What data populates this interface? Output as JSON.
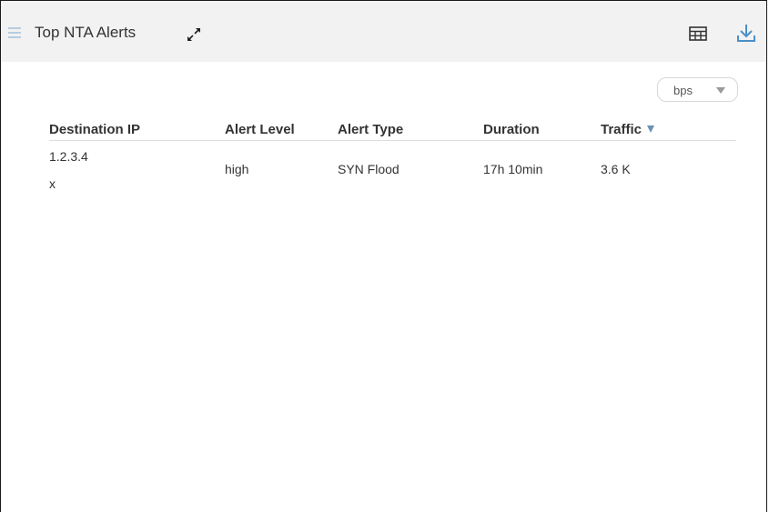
{
  "widget": {
    "title": "Top NTA Alerts",
    "icons": {
      "menu": "hamburger-menu-icon",
      "expand": "expand-arrows-icon",
      "table": "table-view-icon",
      "download": "download-icon"
    },
    "unit_select": {
      "value": "bps"
    }
  },
  "table": {
    "columns": [
      "Destination IP",
      "Alert Level",
      "Alert Type",
      "Duration",
      "Traffic"
    ],
    "sorted_column": "Traffic",
    "rows": [
      {
        "destination_ip": "1.2.3.4",
        "destination_sub": "x",
        "alert_level": "high",
        "alert_type": "SYN Flood",
        "duration": "17h 10min",
        "traffic": "3.6 K"
      }
    ]
  },
  "colors": {
    "header_bg": "#f2f2f2",
    "accent": "#4a90c8",
    "sort_caret": "#6d8fb3"
  }
}
